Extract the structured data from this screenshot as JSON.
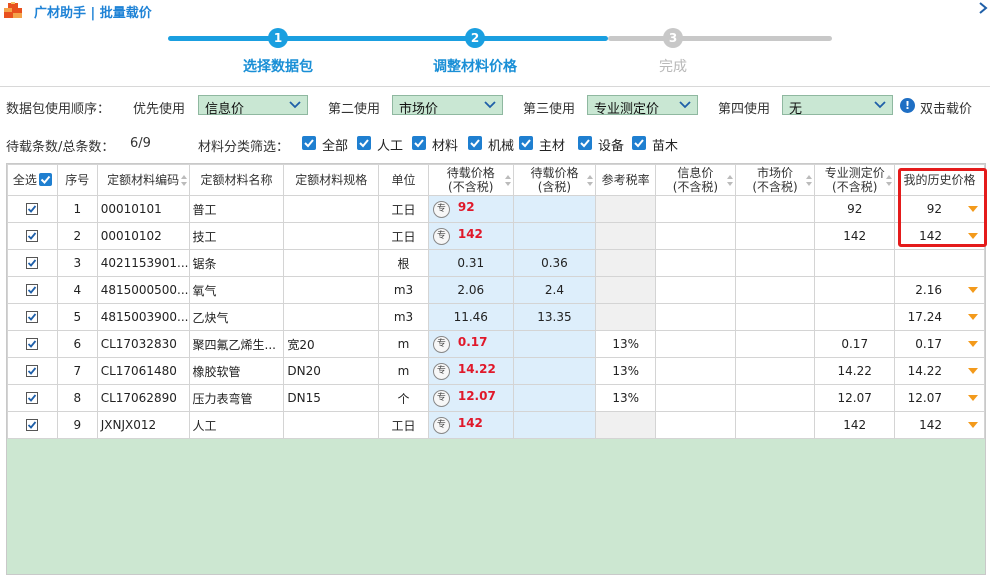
{
  "app": {
    "title": "广材助手 | 批量载价"
  },
  "stepper": {
    "steps": [
      {
        "num": "1",
        "label": "选择数据包",
        "state": "done"
      },
      {
        "num": "2",
        "label": "调整材料价格",
        "state": "done"
      },
      {
        "num": "3",
        "label": "完成",
        "state": "todo"
      }
    ]
  },
  "order": {
    "label": "数据包使用顺序：",
    "first_label": "优先使用",
    "first_value": "信息价",
    "second_label": "第二使用",
    "second_value": "市场价",
    "third_label": "第三使用",
    "third_value": "专业测定价",
    "fourth_label": "第四使用",
    "fourth_value": "无",
    "double_click_label": "双击载价"
  },
  "counts": {
    "label": "待载条数/总条数：",
    "value": "6/9"
  },
  "filter": {
    "label": "材料分类筛选：",
    "options": [
      "全部",
      "人工",
      "材料",
      "机械",
      "主材",
      "设备",
      "苗木"
    ]
  },
  "table": {
    "headers": {
      "select_all": "全选",
      "seq": "序号",
      "code": "定额材料编码",
      "name": "定额材料名称",
      "spec": "定额材料规格",
      "unit": "单位",
      "pending_ex_1": "待载价格",
      "pending_ex_2": "(不含税)",
      "pending_in_1": "待载价格",
      "pending_in_2": "(含税)",
      "tax": "参考税率",
      "info_1": "信息价",
      "info_2": "(不含税)",
      "market_1": "市场价",
      "market_2": "(不含税)",
      "pro_1": "专业测定价",
      "pro_2": "(不含税)",
      "history": "我的历史价格"
    },
    "badge_label": "专",
    "rows": [
      {
        "seq": "1",
        "code": "00010101",
        "name": "普工",
        "spec": "",
        "unit": "工日",
        "pending_ex": "92",
        "pending_in": "",
        "tax": "",
        "info": "",
        "market": "",
        "pro": "92",
        "history": "92",
        "badge": true
      },
      {
        "seq": "2",
        "code": "00010102",
        "name": "技工",
        "spec": "",
        "unit": "工日",
        "pending_ex": "142",
        "pending_in": "",
        "tax": "",
        "info": "",
        "market": "",
        "pro": "142",
        "history": "142",
        "badge": true
      },
      {
        "seq": "3",
        "code": "4021153901...",
        "name": "锯条",
        "spec": "",
        "unit": "根",
        "pending_ex": "0.31",
        "pending_in": "0.36",
        "tax": "",
        "info": "",
        "market": "",
        "pro": "",
        "history": "",
        "badge": false
      },
      {
        "seq": "4",
        "code": "4815000500...",
        "name": "氧气",
        "spec": "",
        "unit": "m3",
        "pending_ex": "2.06",
        "pending_in": "2.4",
        "tax": "",
        "info": "",
        "market": "",
        "pro": "",
        "history": "2.16",
        "badge": false
      },
      {
        "seq": "5",
        "code": "4815003900...",
        "name": "乙炔气",
        "spec": "",
        "unit": "m3",
        "pending_ex": "11.46",
        "pending_in": "13.35",
        "tax": "",
        "info": "",
        "market": "",
        "pro": "",
        "history": "17.24",
        "badge": false
      },
      {
        "seq": "6",
        "code": "CL17032830",
        "name": "聚四氟乙烯生...",
        "spec": "宽20",
        "unit": "m",
        "pending_ex": "0.17",
        "pending_in": "",
        "tax": "13%",
        "info": "",
        "market": "",
        "pro": "0.17",
        "history": "0.17",
        "badge": true
      },
      {
        "seq": "7",
        "code": "CL17061480",
        "name": "橡胶软管",
        "spec": "DN20",
        "unit": "m",
        "pending_ex": "14.22",
        "pending_in": "",
        "tax": "13%",
        "info": "",
        "market": "",
        "pro": "14.22",
        "history": "14.22",
        "badge": true
      },
      {
        "seq": "8",
        "code": "CL17062890",
        "name": "压力表弯管",
        "spec": "DN15",
        "unit": "个",
        "pending_ex": "12.07",
        "pending_in": "",
        "tax": "13%",
        "info": "",
        "market": "",
        "pro": "12.07",
        "history": "12.07",
        "badge": true
      },
      {
        "seq": "9",
        "code": "JXNJX012",
        "name": "人工",
        "spec": "",
        "unit": "工日",
        "pending_ex": "142",
        "pending_in": "",
        "tax": "",
        "info": "",
        "market": "",
        "pro": "142",
        "history": "142",
        "badge": true
      }
    ]
  },
  "colors": {
    "accent": "#1a9fe0",
    "highlight": "#e41b1b",
    "pending_price": "#e0182a",
    "grid_bg": "#cce7d1",
    "dropdown_bg": "#c9e7d3",
    "history_dropdown": "#f39a1b"
  }
}
